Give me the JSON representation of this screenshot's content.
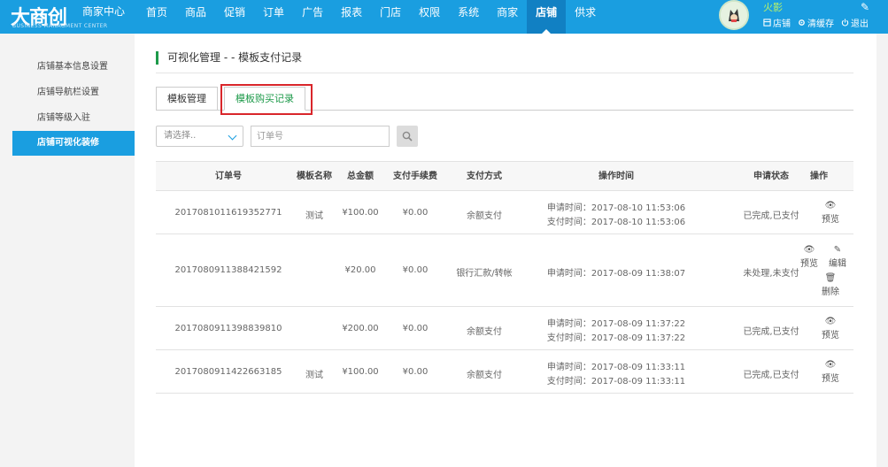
{
  "header": {
    "logo_text": "大商创",
    "logo_center": "商家中心",
    "logo_sub": "BUSINESS MANAGMENT CENTER",
    "nav": [
      "首页",
      "商品",
      "促销",
      "订单",
      "广告",
      "报表",
      "门店",
      "权限",
      "系统",
      "商家",
      "店铺",
      "供求"
    ],
    "active_nav": "店铺",
    "user_name": "火影",
    "actions": {
      "store": "店铺",
      "clear_cache": "清缓存",
      "logout": "退出"
    }
  },
  "sidebar": {
    "items": [
      "店铺基本信息设置",
      "店铺导航栏设置",
      "店铺等级入驻",
      "店铺可视化装修"
    ],
    "active_index": 3
  },
  "page": {
    "title": "可视化管理 - - 模板支付记录",
    "tabs": [
      "模板管理",
      "模板购买记录"
    ],
    "active_tab": 1
  },
  "filter": {
    "select_placeholder": "请选择..",
    "order_placeholder": "订单号"
  },
  "table": {
    "columns": [
      "订单号",
      "模板名称",
      "总金额",
      "支付手续费",
      "支付方式",
      "操作时间",
      "申请状态",
      "操作"
    ],
    "rows": [
      {
        "order_no": "2017081011619352771",
        "template": "测试",
        "total": "¥100.00",
        "fee": "¥0.00",
        "method": "余额支付",
        "apply_time": "申请时间：2017-08-10 11:53:06",
        "pay_time": "支付时间：2017-08-10 11:53:06",
        "status": "已完成,已支付",
        "actions": [
          "预览"
        ]
      },
      {
        "order_no": "2017080911388421592",
        "template": "",
        "total": "¥20.00",
        "fee": "¥0.00",
        "method": "银行汇款/转帐",
        "apply_time": "申请时间：2017-08-09 11:38:07",
        "pay_time": "",
        "status": "未处理,未支付",
        "actions": [
          "预览",
          "编辑",
          "删除"
        ]
      },
      {
        "order_no": "2017080911398839810",
        "template": "",
        "total": "¥200.00",
        "fee": "¥0.00",
        "method": "余额支付",
        "apply_time": "申请时间：2017-08-09 11:37:22",
        "pay_time": "支付时间：2017-08-09 11:37:22",
        "status": "已完成,已支付",
        "actions": [
          "预览"
        ]
      },
      {
        "order_no": "2017080911422663185",
        "template": "测试",
        "total": "¥100.00",
        "fee": "¥0.00",
        "method": "余额支付",
        "apply_time": "申请时间：2017-08-09 11:33:11",
        "pay_time": "支付时间：2017-08-09 11:33:11",
        "status": "已完成,已支付",
        "actions": [
          "预览"
        ]
      }
    ]
  },
  "colors": {
    "topbar": "#1a9ee0",
    "active_nav": "#1180c3",
    "accent_green": "#1d9a4a",
    "highlight_red": "#d9262b",
    "user_name": "#b5f06b"
  },
  "icons": {
    "preview": "eye-icon",
    "edit": "edit-icon",
    "delete": "trash-icon",
    "search": "search-icon",
    "store": "store-icon",
    "clear_cache": "gear-icon",
    "logout": "power-icon"
  }
}
